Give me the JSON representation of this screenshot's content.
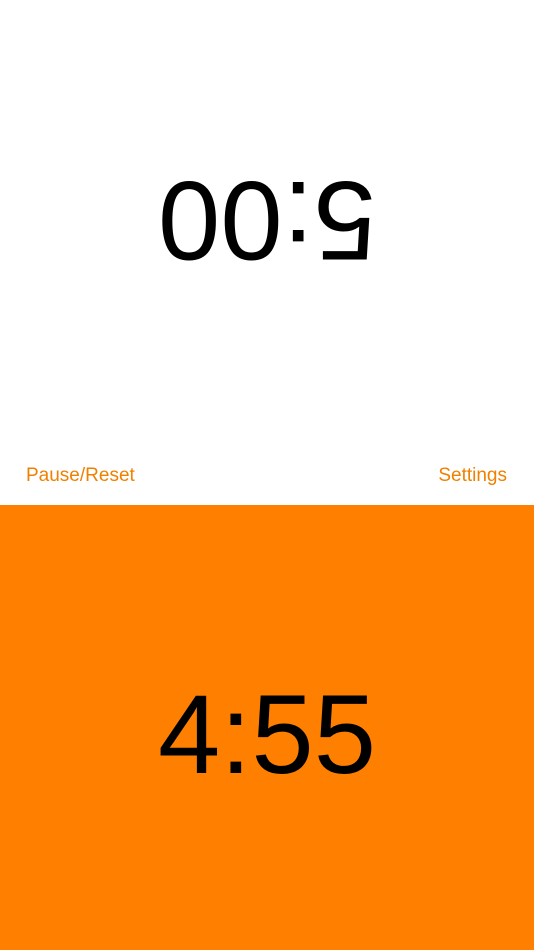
{
  "top_player": {
    "time": "5:00",
    "orientation": "upside-down",
    "background_color": "#FFFFFF"
  },
  "controls": {
    "pause_reset_label": "Pause/Reset",
    "settings_label": "Settings",
    "accent_color": "#F08000"
  },
  "bottom_player": {
    "time": "4:55",
    "background_color": "#FF8000",
    "active": true
  }
}
